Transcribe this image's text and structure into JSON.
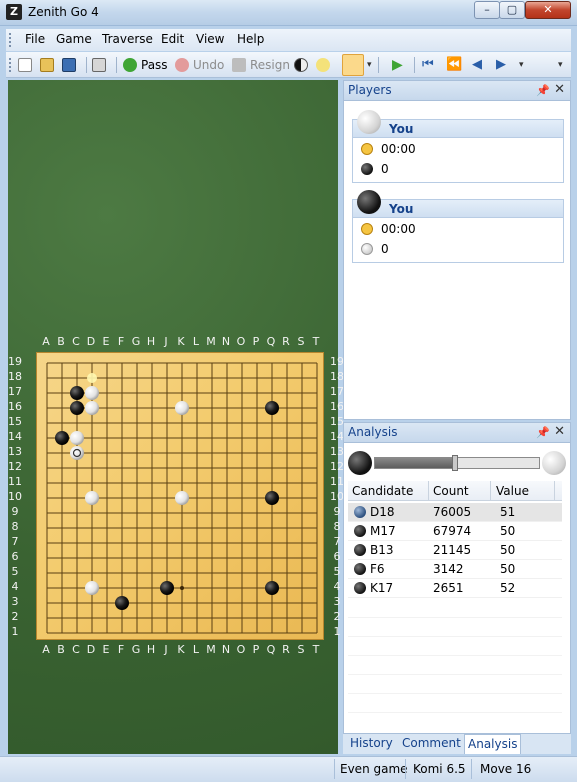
{
  "window": {
    "title": "Zenith Go 4",
    "controls": [
      "–",
      "▢",
      "✕"
    ]
  },
  "menu": [
    "File",
    "Game",
    "Traverse",
    "Edit",
    "View",
    "Help"
  ],
  "toolbar": {
    "pass": "Pass",
    "undo": "Undo",
    "resign": "Resign"
  },
  "board": {
    "columns": [
      "A",
      "B",
      "C",
      "D",
      "E",
      "F",
      "G",
      "H",
      "J",
      "K",
      "L",
      "M",
      "N",
      "O",
      "P",
      "Q",
      "R",
      "S",
      "T"
    ],
    "rows": [
      "19",
      "18",
      "17",
      "16",
      "15",
      "14",
      "13",
      "12",
      "11",
      "10",
      "9",
      "8",
      "7",
      "6",
      "5",
      "4",
      "3",
      "2",
      "1"
    ],
    "stones": [
      {
        "point": "C17",
        "color": "black"
      },
      {
        "point": "D17",
        "color": "white"
      },
      {
        "point": "C16",
        "color": "black"
      },
      {
        "point": "D16",
        "color": "white"
      },
      {
        "point": "K16",
        "color": "white"
      },
      {
        "point": "Q16",
        "color": "black"
      },
      {
        "point": "B14",
        "color": "black"
      },
      {
        "point": "C14",
        "color": "white"
      },
      {
        "point": "C13",
        "color": "white",
        "last": true
      },
      {
        "point": "D10",
        "color": "white"
      },
      {
        "point": "K10",
        "color": "white"
      },
      {
        "point": "Q10",
        "color": "black"
      },
      {
        "point": "D4",
        "color": "white"
      },
      {
        "point": "J4",
        "color": "black"
      },
      {
        "point": "Q4",
        "color": "black"
      },
      {
        "point": "F3",
        "color": "black"
      }
    ],
    "hint_point": "D18"
  },
  "players_panel": {
    "title": "Players",
    "players": [
      {
        "name": "You",
        "stone": "white",
        "time": "00:00",
        "captures": "0"
      },
      {
        "name": "You",
        "stone": "black",
        "time": "00:00",
        "captures": "0"
      }
    ]
  },
  "analysis_panel": {
    "title": "Analysis",
    "balance_fraction": 0.49,
    "columns": [
      "Candidate",
      "Count",
      "Value"
    ],
    "rows": [
      {
        "candidate": "D18",
        "count": "76005",
        "value": "51"
      },
      {
        "candidate": "M17",
        "count": "67974",
        "value": "50"
      },
      {
        "candidate": "B13",
        "count": "21145",
        "value": "50"
      },
      {
        "candidate": "F6",
        "count": "3142",
        "value": "50"
      },
      {
        "candidate": "K17",
        "count": "2651",
        "value": "52"
      }
    ]
  },
  "tabs": {
    "history": "History",
    "comment": "Comment",
    "analysis": "Analysis"
  },
  "status": {
    "game": "Even game",
    "komi": "Komi 6.5",
    "move": "Move 16"
  }
}
